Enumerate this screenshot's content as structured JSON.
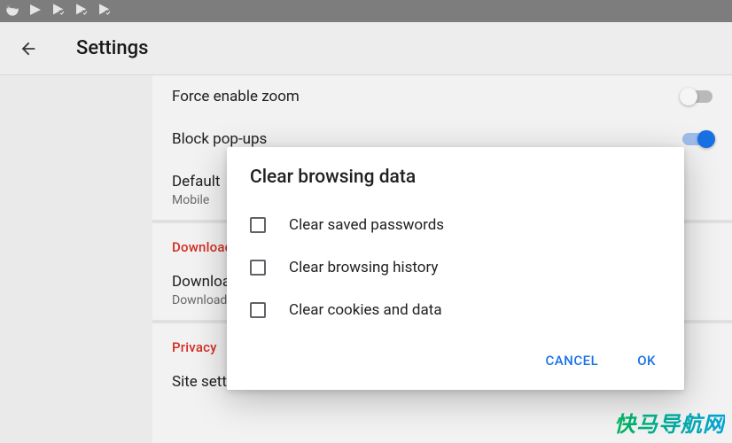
{
  "header": {
    "title": "Settings"
  },
  "statusbar": {
    "icons": [
      "firefox-icon",
      "play-send-icon",
      "play-send-badge-icon",
      "play-send-badge-icon",
      "play-send-badge-icon"
    ]
  },
  "settings": {
    "group1": {
      "forceZoom": {
        "label": "Force enable zoom",
        "on": false
      },
      "blockPopups": {
        "label": "Block pop-ups",
        "on": true
      },
      "defaultView": {
        "label": "Default",
        "sublabel": "Mobile"
      }
    },
    "downloads": {
      "header": "Downloads",
      "downloadPath": {
        "label": "Download",
        "sublabel": "Download"
      }
    },
    "privacy": {
      "header": "Privacy",
      "siteSettings": {
        "label": "Site settings"
      }
    }
  },
  "dialog": {
    "title": "Clear browsing data",
    "items": {
      "passwords": "Clear saved passwords",
      "history": "Clear browsing history",
      "cookies": "Clear cookies and data"
    },
    "actions": {
      "cancel": "CANCEL",
      "ok": "OK"
    }
  },
  "watermark": "快马导航网"
}
